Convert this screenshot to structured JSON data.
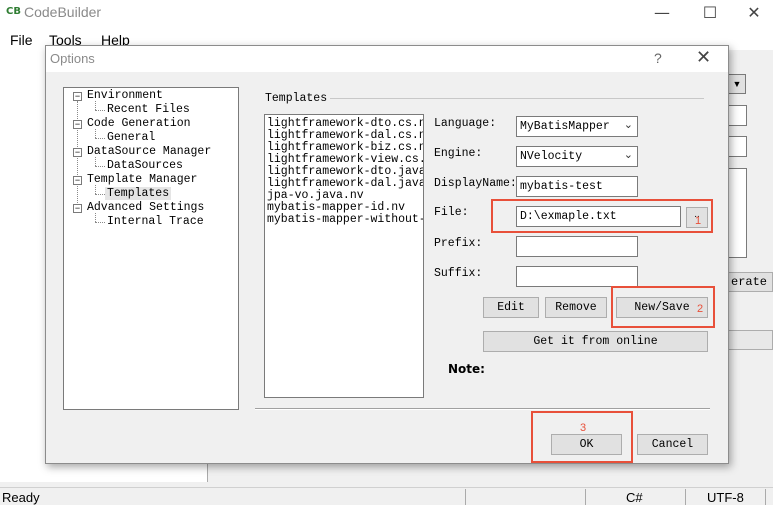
{
  "app": {
    "title": "CodeBuilder",
    "icon": "code-builder-icon",
    "window_buttons": {
      "minimize": "—",
      "maximize": "☐",
      "close": "✕"
    }
  },
  "menu": {
    "file": "File",
    "tools": "Tools",
    "help": "Help"
  },
  "background": {
    "generate_partial": "erate"
  },
  "status": {
    "left": "Ready",
    "lang": "C#",
    "encoding": "UTF-8"
  },
  "dialog": {
    "title": "Options",
    "help": "?",
    "close": "✕",
    "tree": [
      {
        "label": "Environment",
        "children": [
          "Recent Files"
        ]
      },
      {
        "label": "Code Generation",
        "children": [
          "General"
        ]
      },
      {
        "label": "DataSource Manager",
        "children": [
          "DataSources"
        ]
      },
      {
        "label": "Template Manager",
        "children": [
          "Templates"
        ]
      },
      {
        "label": "Advanced Settings",
        "children": [
          "Internal Trace"
        ]
      }
    ],
    "group_label": "Templates",
    "templates": [
      "lightframework-dto.cs.nv",
      "lightframework-dal.cs.nv",
      "lightframework-biz.cs.nv",
      "lightframework-view.cs.nv",
      "lightframework-dto.java.nv",
      "lightframework-dal.java.nv",
      "jpa-vo.java.nv",
      "mybatis-mapper-id.nv",
      "mybatis-mapper-without-id."
    ],
    "fields": {
      "language_label": "Language:",
      "language_value": "MyBatisMapper",
      "engine_label": "Engine:",
      "engine_value": "NVelocity",
      "displayname_label": "DisplayName:",
      "displayname_value": "mybatis-test",
      "file_label": "File:",
      "file_value": "D:\\exmaple.txt",
      "browse": "..",
      "prefix_label": "Prefix:",
      "prefix_value": "",
      "suffix_label": "Suffix:",
      "suffix_value": ""
    },
    "buttons": {
      "edit": "Edit",
      "remove": "Remove",
      "newsave": "New/Save",
      "get_online": "Get it from online",
      "ok": "OK",
      "cancel": "Cancel"
    },
    "note_label": "Note:",
    "annotations": {
      "one": "1",
      "two": "2",
      "three": "3"
    }
  }
}
